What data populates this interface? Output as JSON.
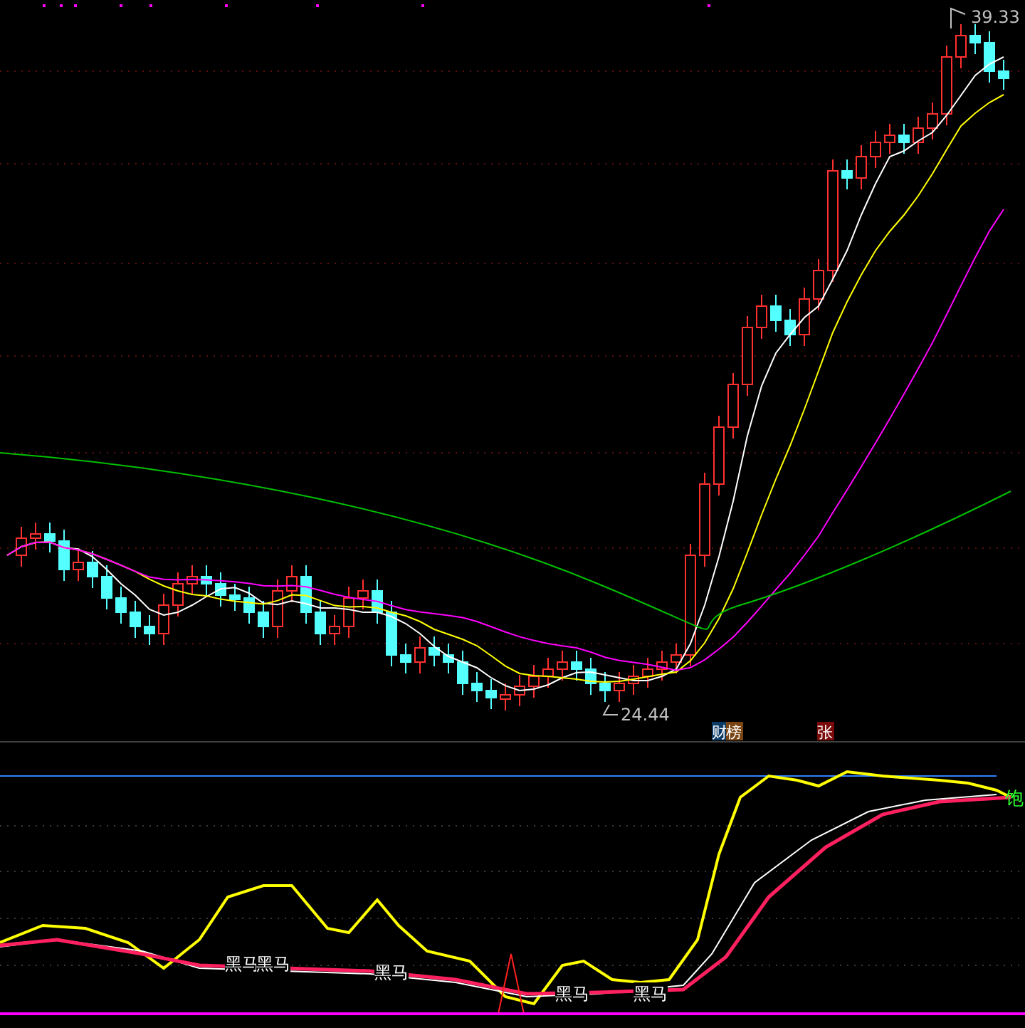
{
  "price_pane": {
    "high_label": "39.33",
    "low_label": "24.44"
  },
  "badges": [
    {
      "text": "财",
      "color": "#0b3a66"
    },
    {
      "text": "榜",
      "color": "#7a4412"
    },
    {
      "text": "张",
      "color": "#7a0a0a"
    }
  ],
  "indicator_pane": {
    "signals": [
      {
        "text": "黑马"
      },
      {
        "text": "黑马"
      },
      {
        "text": "黑马"
      },
      {
        "text": "黑马"
      },
      {
        "text": "黑马"
      }
    ],
    "end_label": "饱"
  }
}
